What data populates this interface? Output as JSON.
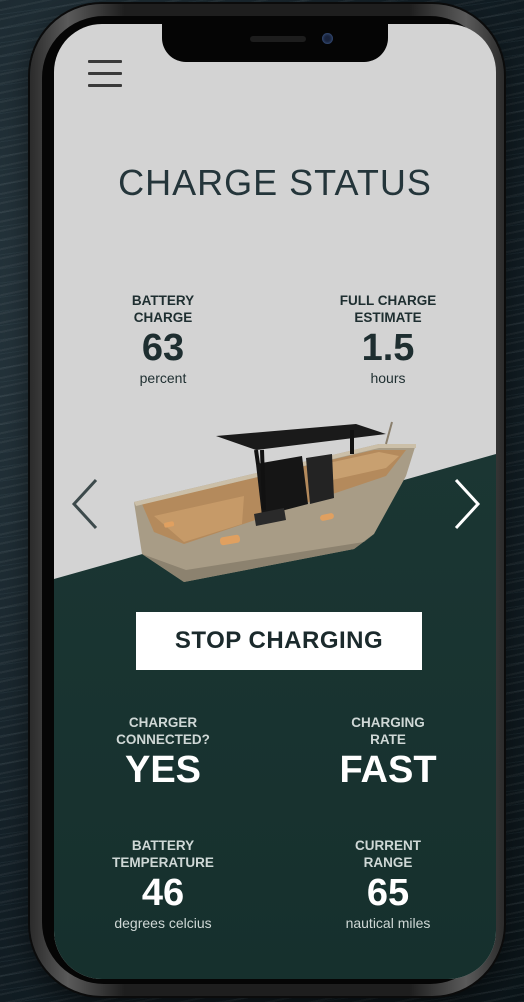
{
  "header": {
    "title": "CHARGE STATUS"
  },
  "icons": {
    "menu": "hamburger-menu-icon",
    "prev": "chevron-left-icon",
    "next": "chevron-right-icon"
  },
  "top_stats": {
    "battery_charge": {
      "label_line1": "BATTERY",
      "label_line2": "CHARGE",
      "value": "63",
      "unit": "percent"
    },
    "full_charge_estimate": {
      "label_line1": "FULL CHARGE",
      "label_line2": "ESTIMATE",
      "value": "1.5",
      "unit": "hours"
    }
  },
  "action": {
    "stop_label": "STOP CHARGING"
  },
  "bottom_stats": {
    "charger_connected": {
      "label_line1": "CHARGER",
      "label_line2": "CONNECTED?",
      "value": "YES"
    },
    "charging_rate": {
      "label_line1": "CHARGING",
      "label_line2": "RATE",
      "value": "FAST"
    },
    "battery_temperature": {
      "label_line1": "BATTERY",
      "label_line2": "TEMPERATURE",
      "value": "46",
      "unit": "degrees celcius"
    },
    "current_range": {
      "label_line1": "CURRENT",
      "label_line2": "RANGE",
      "value": "65",
      "unit": "nautical miles"
    }
  },
  "colors": {
    "screen_top": "#d3d3d3",
    "screen_bottom": "#1f3b38",
    "title": "#24353a"
  }
}
